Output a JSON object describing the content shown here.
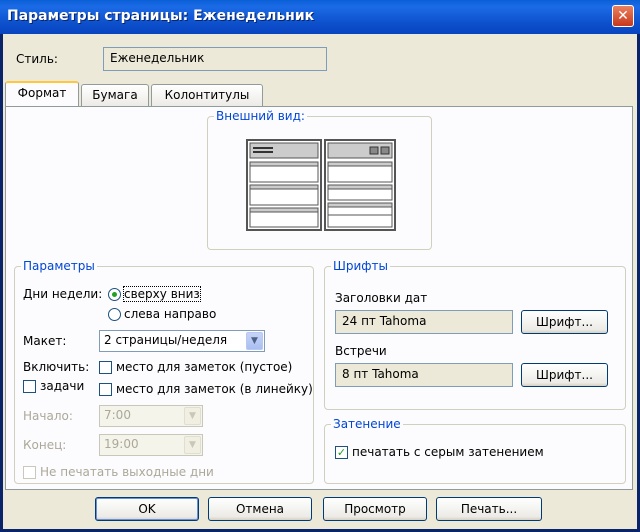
{
  "window": {
    "title": "Параметры страницы: Еженедельник",
    "close_glyph": "✕"
  },
  "style": {
    "label": "Стиль:",
    "value": "Еженедельник"
  },
  "tabs": [
    {
      "label": "Формат",
      "active": true
    },
    {
      "label": "Бумага",
      "active": false
    },
    {
      "label": "Колонтитулы",
      "active": false
    }
  ],
  "appearance": {
    "title": "Внешний вид:"
  },
  "params": {
    "title": "Параметры",
    "weekdays_label": "Дни недели:",
    "order_options": [
      {
        "label": "сверху вниз",
        "selected": true
      },
      {
        "label": "слева направо",
        "selected": false
      }
    ],
    "layout_label": "Макет:",
    "layout_value": "2 страницы/неделя",
    "include_label": "Включить:",
    "include_options": [
      {
        "label": "место для заметок (пустое)",
        "checked": false
      },
      {
        "label": "задачи",
        "checked": false
      },
      {
        "label": "место для заметок (в линейку)",
        "checked": false
      }
    ],
    "start_label": "Начало:",
    "start_value": "7:00",
    "end_label": "Конец:",
    "end_value": "19:00",
    "no_weekends_label": "Не печатать выходные дни"
  },
  "fonts": {
    "title": "Шрифты",
    "date_headers_label": "Заголовки дат",
    "date_headers_value": "24 пт Tahoma",
    "date_headers_button": "Шрифт...",
    "appointments_label": "Встречи",
    "appointments_value": "8 пт Tahoma",
    "appointments_button": "Шрифт..."
  },
  "shading": {
    "title": "Затенение",
    "print_gray_label": "печатать с серым затенением",
    "checked": true
  },
  "buttons": {
    "ok": "OK",
    "cancel": "Отмена",
    "preview": "Просмотр",
    "print": "Печать..."
  }
}
